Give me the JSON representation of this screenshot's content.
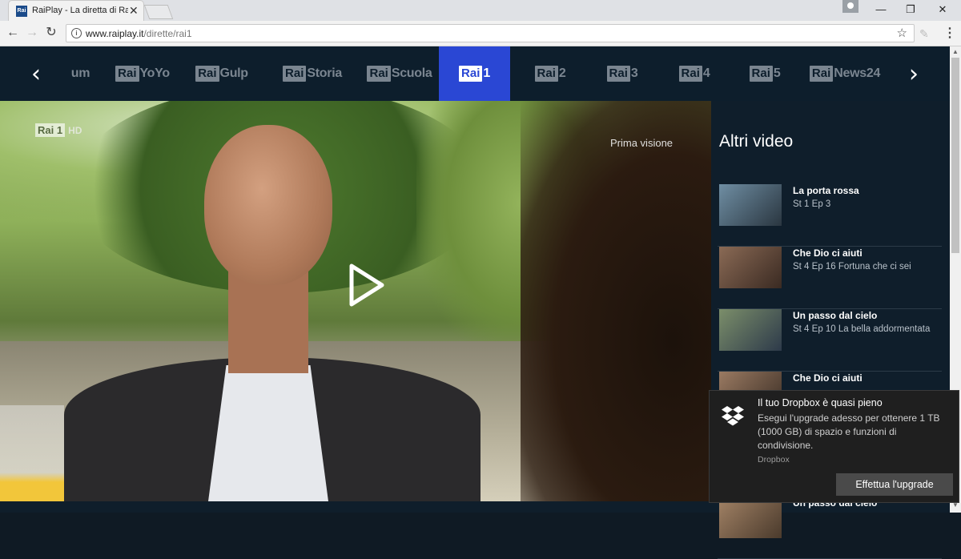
{
  "browser": {
    "tab_title": "RaiPlay - La diretta di Ra",
    "tab_favicon": "Rai",
    "close_glyph": "✕",
    "url_host": "www.raiplay.it",
    "url_path": "/dirette/rai1",
    "window_controls": {
      "minimize": "—",
      "restore": "❐",
      "close": "✕"
    }
  },
  "channels": [
    {
      "rai": "",
      "name": "um"
    },
    {
      "rai": "Rai",
      "name": "YoYo"
    },
    {
      "rai": "Rai",
      "name": "Gulp"
    },
    {
      "rai": "Rai",
      "name": "Storia"
    },
    {
      "rai": "Rai",
      "name": "Scuola"
    },
    {
      "rai": "Rai",
      "name": "1",
      "active": true
    },
    {
      "rai": "Rai",
      "name": "2"
    },
    {
      "rai": "Rai",
      "name": "3"
    },
    {
      "rai": "Rai",
      "name": "4"
    },
    {
      "rai": "Rai",
      "name": "5"
    },
    {
      "rai": "Rai",
      "name": "News24"
    }
  ],
  "player": {
    "watermark_logo": "Rai 1",
    "watermark_hd": "HD",
    "overlay_text": "Prima visione"
  },
  "sidebar": {
    "title": "Altri video",
    "items": [
      {
        "title": "La porta rossa",
        "subtitle": "St 1 Ep 3"
      },
      {
        "title": "Che Dio ci aiuti",
        "subtitle": "St 4 Ep 16 Fortuna che ci sei"
      },
      {
        "title": "Un passo dal cielo",
        "subtitle": "St 4 Ep 10 La bella addormentata"
      },
      {
        "title": "Che Dio ci aiuti",
        "subtitle": ""
      },
      {
        "title": "Un passo dal cielo",
        "subtitle": ""
      }
    ]
  },
  "toast": {
    "title": "Il tuo Dropbox è quasi pieno",
    "body": "Esegui l'upgrade adesso per ottenere 1 TB (1000 GB) di spazio e funzioni di condivisione.",
    "source": "Dropbox",
    "action": "Effettua l'upgrade"
  }
}
